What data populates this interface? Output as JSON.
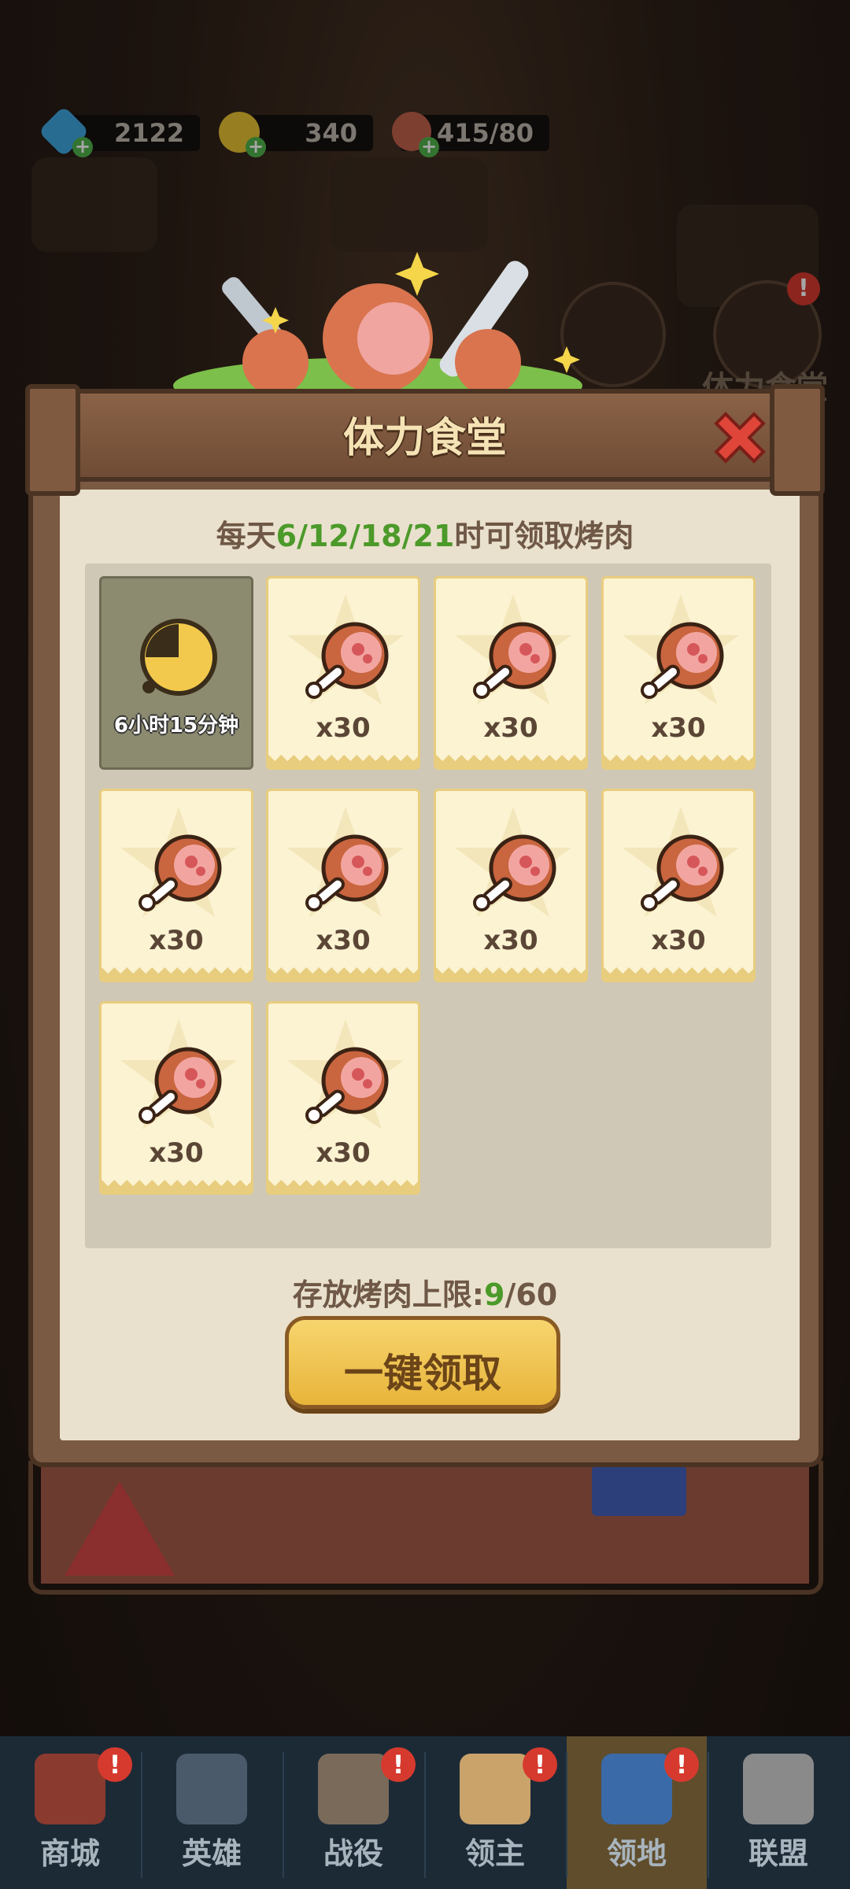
{
  "currencies": [
    {
      "name": "diamond",
      "value": "2122",
      "icon": "diamond-icon",
      "color": "#3fa7e0"
    },
    {
      "name": "gold",
      "value": "340",
      "icon": "gold-coin-icon",
      "color": "#e9c233"
    },
    {
      "name": "meat",
      "value": "415/80",
      "icon": "meat-icon",
      "color": "#c0614a"
    }
  ],
  "background": {
    "side_label": "体力食堂"
  },
  "panel": {
    "title": "体力食堂",
    "subtitle_prefix": "每天",
    "subtitle_times": "6/12/18/21",
    "subtitle_suffix": "时可领取烤肉",
    "timer_text": "6小时15分钟",
    "rewards": [
      {
        "qty": "x30"
      },
      {
        "qty": "x30"
      },
      {
        "qty": "x30"
      },
      {
        "qty": "x30"
      },
      {
        "qty": "x30"
      },
      {
        "qty": "x30"
      },
      {
        "qty": "x30"
      },
      {
        "qty": "x30"
      },
      {
        "qty": "x30"
      }
    ],
    "limit_label": "存放烤肉上限:",
    "limit_current": "9",
    "limit_max": "/60",
    "claim_button": "一键领取"
  },
  "nav": {
    "items": [
      {
        "label": "商城",
        "alert": "!",
        "icon": "shop-icon"
      },
      {
        "label": "英雄",
        "alert": "",
        "icon": "hero-cards-icon"
      },
      {
        "label": "战役",
        "alert": "!",
        "icon": "swords-icon"
      },
      {
        "label": "领主",
        "alert": "!",
        "icon": "lord-icon"
      },
      {
        "label": "领地",
        "alert": "!",
        "icon": "castle-icon"
      },
      {
        "label": "联盟",
        "alert": "",
        "icon": "knight-helmet-icon"
      }
    ],
    "active_index": 4
  },
  "colors": {
    "highlight_green": "#4c9a2a",
    "card_bg": "#fbf3d2",
    "button_gold": "#f0c24e"
  }
}
